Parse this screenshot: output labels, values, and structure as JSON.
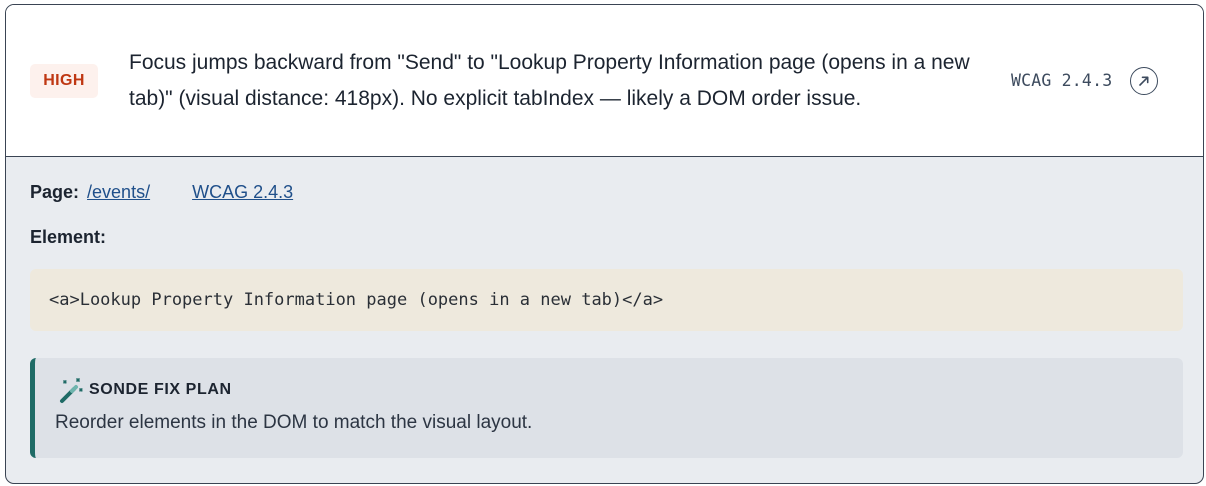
{
  "issue": {
    "severity": "HIGH",
    "summary": "Focus jumps backward from \"Send\" to \"Lookup Property Information page (opens in a new tab)\" (visual distance: 418px). No explicit tabIndex — likely a DOM order issue.",
    "criterion": "WCAG 2.4.3",
    "open_icon": "external-link-icon"
  },
  "details": {
    "page_label": "Page:",
    "page_link": "/events/",
    "wcag_link": "WCAG 2.4.3",
    "element_label": "Element:",
    "element_code": "<a>Lookup Property Information page (opens in a new tab)</a>"
  },
  "fix_plan": {
    "icon": "magic-wand-icon",
    "title": "SONDE FIX PLAN",
    "text": "Reorder elements in the DOM to match the visual layout."
  },
  "colors": {
    "severity_high": "#bf3712",
    "severity_bg": "#fdf1ed",
    "link": "#1f4f8a",
    "fix_accent": "#1f6b66",
    "code_bg": "#eee9dd"
  }
}
